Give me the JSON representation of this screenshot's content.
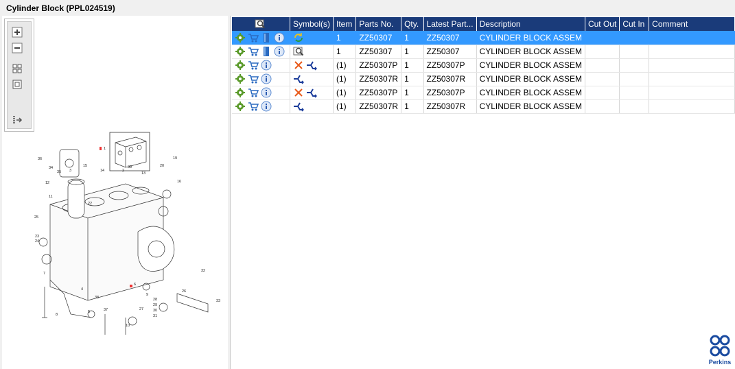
{
  "window": {
    "title": "Cylinder Block (PPL024519)"
  },
  "toolbar": {
    "buttons": [
      {
        "name": "zoom-in",
        "icon": "plus-icon"
      },
      {
        "name": "zoom-out",
        "icon": "minus-icon"
      },
      {
        "name": "fit-all",
        "icon": "grid-icon"
      },
      {
        "name": "fit-window",
        "icon": "square-icon"
      },
      {
        "name": "export",
        "icon": "list-arrow-icon"
      }
    ]
  },
  "diagram": {
    "callouts": [
      "1",
      "2",
      "3",
      "4",
      "5",
      "6",
      "7",
      "8",
      "9",
      "10",
      "11",
      "12",
      "13",
      "14",
      "15",
      "16",
      "19",
      "20",
      "22",
      "23",
      "24",
      "25",
      "26",
      "27",
      "28",
      "29",
      "30",
      "31",
      "32",
      "33",
      "34",
      "35",
      "36",
      "37",
      "38",
      "39"
    ]
  },
  "grid": {
    "columns": [
      "",
      "Symbol(s)",
      "Item",
      "Parts No.",
      "Qty.",
      "Latest Part...",
      "Description",
      "Cut Out",
      "Cut In",
      "Comment"
    ],
    "rows": [
      {
        "selected": true,
        "icons": [
          "gear-icon",
          "cart-icon",
          "book-icon",
          "info-icon"
        ],
        "symbols": [
          "cycle-icon"
        ],
        "item": "1",
        "part": "ZZ50307",
        "qty": "1",
        "latest": "ZZ50307",
        "desc": "CYLINDER BLOCK ASSEM",
        "cutout": "",
        "cutin": "",
        "comment": ""
      },
      {
        "selected": false,
        "icons": [
          "gear-icon",
          "cart-icon",
          "book-icon",
          "info-icon"
        ],
        "symbols": [
          "magnifier-icon"
        ],
        "item": "1",
        "part": "ZZ50307",
        "qty": "1",
        "latest": "ZZ50307",
        "desc": "CYLINDER BLOCK ASSEM",
        "cutout": "",
        "cutin": "",
        "comment": ""
      },
      {
        "selected": false,
        "icons": [
          "gear-icon",
          "cart-icon",
          "info-icon"
        ],
        "symbols": [
          "cross-icon",
          "split-arrow-icon"
        ],
        "item": "(1)",
        "part": "ZZ50307P",
        "qty": "1",
        "latest": "ZZ50307P",
        "desc": "CYLINDER BLOCK ASSEM",
        "cutout": "",
        "cutin": "",
        "comment": ""
      },
      {
        "selected": false,
        "icons": [
          "gear-icon",
          "cart-icon",
          "info-icon"
        ],
        "symbols": [
          "split-arrow-icon"
        ],
        "item": "(1)",
        "part": "ZZ50307R",
        "qty": "1",
        "latest": "ZZ50307R",
        "desc": "CYLINDER BLOCK ASSEM",
        "cutout": "",
        "cutin": "",
        "comment": ""
      },
      {
        "selected": false,
        "icons": [
          "gear-icon",
          "cart-icon",
          "info-icon"
        ],
        "symbols": [
          "cross-icon",
          "split-arrow-icon"
        ],
        "item": "(1)",
        "part": "ZZ50307P",
        "qty": "1",
        "latest": "ZZ50307P",
        "desc": "CYLINDER BLOCK ASSEM",
        "cutout": "",
        "cutin": "",
        "comment": ""
      },
      {
        "selected": false,
        "icons": [
          "gear-icon",
          "cart-icon",
          "info-icon"
        ],
        "symbols": [
          "split-arrow-icon"
        ],
        "item": "(1)",
        "part": "ZZ50307R",
        "qty": "1",
        "latest": "ZZ50307R",
        "desc": "CYLINDER BLOCK ASSEM",
        "cutout": "",
        "cutin": "",
        "comment": ""
      }
    ]
  },
  "logo": {
    "text": "Perkins"
  },
  "colors": {
    "header": "#1a3b7a",
    "selection": "#3399ff",
    "logo": "#1a4ba0"
  }
}
